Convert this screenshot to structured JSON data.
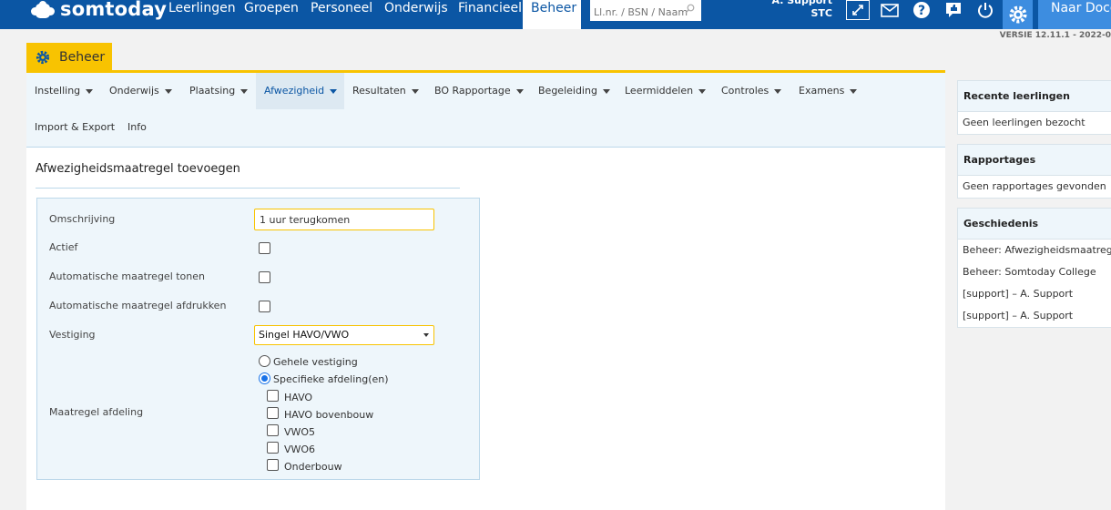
{
  "topbar": {
    "logo": "somtoday",
    "nav": [
      "Leerlingen",
      "Groepen",
      "Personeel",
      "Onderwijs",
      "Financieel",
      "Beheer"
    ],
    "active_nav": "Beheer",
    "search_placeholder": "Ll.nr. / BSN / Naam",
    "user_name": "A. Support",
    "user_org": "STC",
    "icons": [
      "expand-icon",
      "mail-icon",
      "help-icon",
      "feedback-icon",
      "power-icon",
      "gear-icon"
    ],
    "naar_label": "Naar Docent"
  },
  "versie": "VERSIE 12.11.1 - 2022-0",
  "module_tab": "Beheer",
  "submenu": [
    {
      "label": "Instelling"
    },
    {
      "label": "Onderwijs"
    },
    {
      "label": "Plaatsing"
    },
    {
      "label": "Afwezigheid",
      "active": true
    },
    {
      "label": "Resultaten"
    },
    {
      "label": "BO Rapportage"
    },
    {
      "label": "Begeleiding"
    },
    {
      "label": "Leermiddelen"
    },
    {
      "label": "Controles"
    },
    {
      "label": "Examens"
    },
    {
      "label": "Import & Export"
    },
    {
      "label": "Info"
    }
  ],
  "page_title": "Afwezigheidsmaatregel toevoegen",
  "form": {
    "omschrijving_label": "Omschrijving",
    "omschrijving_value": "1 uur terugkomen",
    "actief_label": "Actief",
    "auto_tonen_label": "Automatische maatregel tonen",
    "auto_afdrukken_label": "Automatische maatregel afdrukken",
    "vestiging_label": "Vestiging",
    "vestiging_value": "Singel HAVO/VWO",
    "maatregel_afdeling_label": "Maatregel afdeling",
    "radio_options": [
      "Gehele vestiging",
      "Specifieke afdeling(en)"
    ],
    "selected_radio": "Specifieke afdeling(en)",
    "afdelingen": [
      "HAVO",
      "HAVO bovenbouw",
      "VWO5",
      "VWO6",
      "Onderbouw"
    ]
  },
  "widgets": {
    "recent_title": "Recente leerlingen",
    "recent_empty": "Geen leerlingen bezocht",
    "rapportages_title": "Rapportages",
    "rapportages_empty": "Geen rapportages gevonden",
    "geschiedenis_title": "Geschiedenis",
    "geschiedenis": [
      "Beheer: Afwezigheidsmaatregelen",
      "Beheer: Somtoday College",
      "[support] – A. Support",
      "[support] – A. Support"
    ]
  },
  "colors": {
    "primary": "#0b56a4",
    "accent": "#f8c301",
    "light_blue": "#eef6fb"
  }
}
